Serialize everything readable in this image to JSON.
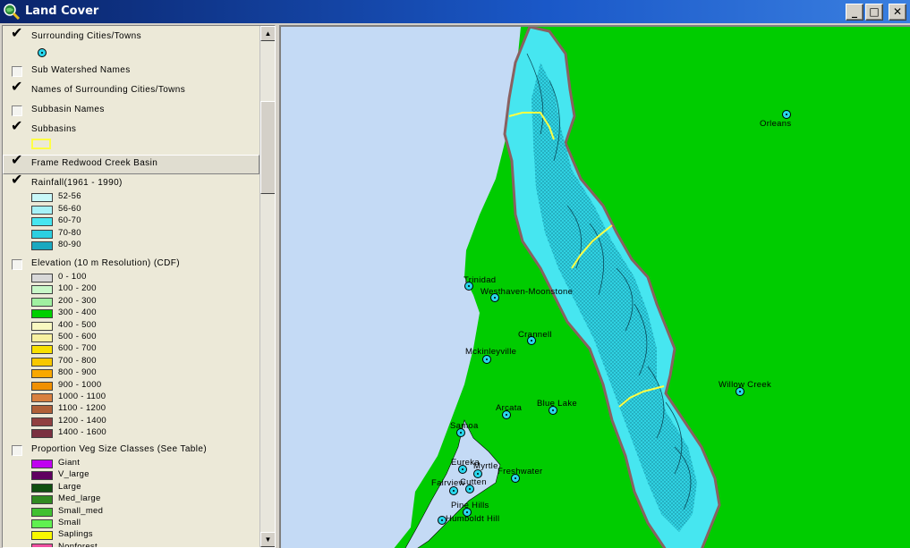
{
  "window": {
    "title": "Land Cover",
    "buttons": {
      "minimize": "_",
      "maximize": "□",
      "close": "✕"
    }
  },
  "legend": {
    "layers": [
      {
        "id": "surrounding-cities",
        "name": "Surrounding Cities/Towns",
        "checked": true
      },
      {
        "id": "subwatershed-names",
        "name": "Sub Watershed Names",
        "checked": false
      },
      {
        "id": "names-surrounding",
        "name": "Names of Surrounding Cities/Towns",
        "checked": true
      },
      {
        "id": "subbasin-names",
        "name": "Subbasin Names",
        "checked": false
      },
      {
        "id": "subbasins",
        "name": "Subbasins",
        "checked": true
      },
      {
        "id": "frame-redwood",
        "name": "Frame Redwood Creek Basin",
        "checked": true
      },
      {
        "id": "rainfall",
        "name": "Rainfall(1961 - 1990)",
        "checked": true
      },
      {
        "id": "elevation",
        "name": "Elevation (10 m Resolution) (CDF)",
        "checked": false
      },
      {
        "id": "veg-size",
        "name": "Proportion Veg Size Classes (See Table)",
        "checked": false
      }
    ],
    "rainfall_classes": [
      {
        "label": "52-56",
        "color": "#c8f8f8"
      },
      {
        "label": "56-60",
        "color": "#a6f2f7"
      },
      {
        "label": "60-70",
        "color": "#46e6f0"
      },
      {
        "label": "70-80",
        "color": "#2ccfe0"
      },
      {
        "label": "80-90",
        "color": "#1aa9c0"
      }
    ],
    "elevation_classes": [
      {
        "label": "0 - 100",
        "color": "#d8d8d8"
      },
      {
        "label": "100 - 200",
        "color": "#c8f8c8"
      },
      {
        "label": "200 - 300",
        "color": "#a0f0a0"
      },
      {
        "label": "300 - 400",
        "color": "#00d000"
      },
      {
        "label": "400 - 500",
        "color": "#f8f8c0"
      },
      {
        "label": "500 - 600",
        "color": "#f8f0a0"
      },
      {
        "label": "600 - 700",
        "color": "#f8e000"
      },
      {
        "label": "700 - 800",
        "color": "#f8c800"
      },
      {
        "label": "800 - 900",
        "color": "#f8a800"
      },
      {
        "label": "900 - 1000",
        "color": "#f09000"
      },
      {
        "label": "1000 - 1100",
        "color": "#d88040"
      },
      {
        "label": "1100 - 1200",
        "color": "#b06038"
      },
      {
        "label": "1200 - 1400",
        "color": "#904040"
      },
      {
        "label": "1400 - 1600",
        "color": "#7a3040"
      }
    ],
    "veg_classes": [
      {
        "label": "Giant",
        "color": "#c000f0"
      },
      {
        "label": "V_large",
        "color": "#600060"
      },
      {
        "label": "Large",
        "color": "#105010"
      },
      {
        "label": "Med_large",
        "color": "#308a20"
      },
      {
        "label": "Small_med",
        "color": "#40c030"
      },
      {
        "label": "Small",
        "color": "#60f050"
      },
      {
        "label": "Saplings",
        "color": "#f8f800"
      },
      {
        "label": "Nonforest",
        "color": "#f050a0"
      }
    ]
  },
  "map": {
    "colors": {
      "ocean": "#c4daf5",
      "land": "#00cc00",
      "basin_border": "#8a6060",
      "subbasin": "#ffff44"
    },
    "towns": [
      {
        "name": "Orleans"
      },
      {
        "name": "Trinidad"
      },
      {
        "name": "Westhaven-Moonstone"
      },
      {
        "name": "Crannell"
      },
      {
        "name": "Mckinleyville"
      },
      {
        "name": "Willow Creek"
      },
      {
        "name": "Arcata"
      },
      {
        "name": "Blue Lake"
      },
      {
        "name": "Samoa"
      },
      {
        "name": "Eureka"
      },
      {
        "name": "Myrtle"
      },
      {
        "name": "Freshwater"
      },
      {
        "name": "Fairview"
      },
      {
        "name": "Cutten"
      },
      {
        "name": "Pine Hills"
      },
      {
        "name": "Humboldt Hill"
      }
    ]
  }
}
